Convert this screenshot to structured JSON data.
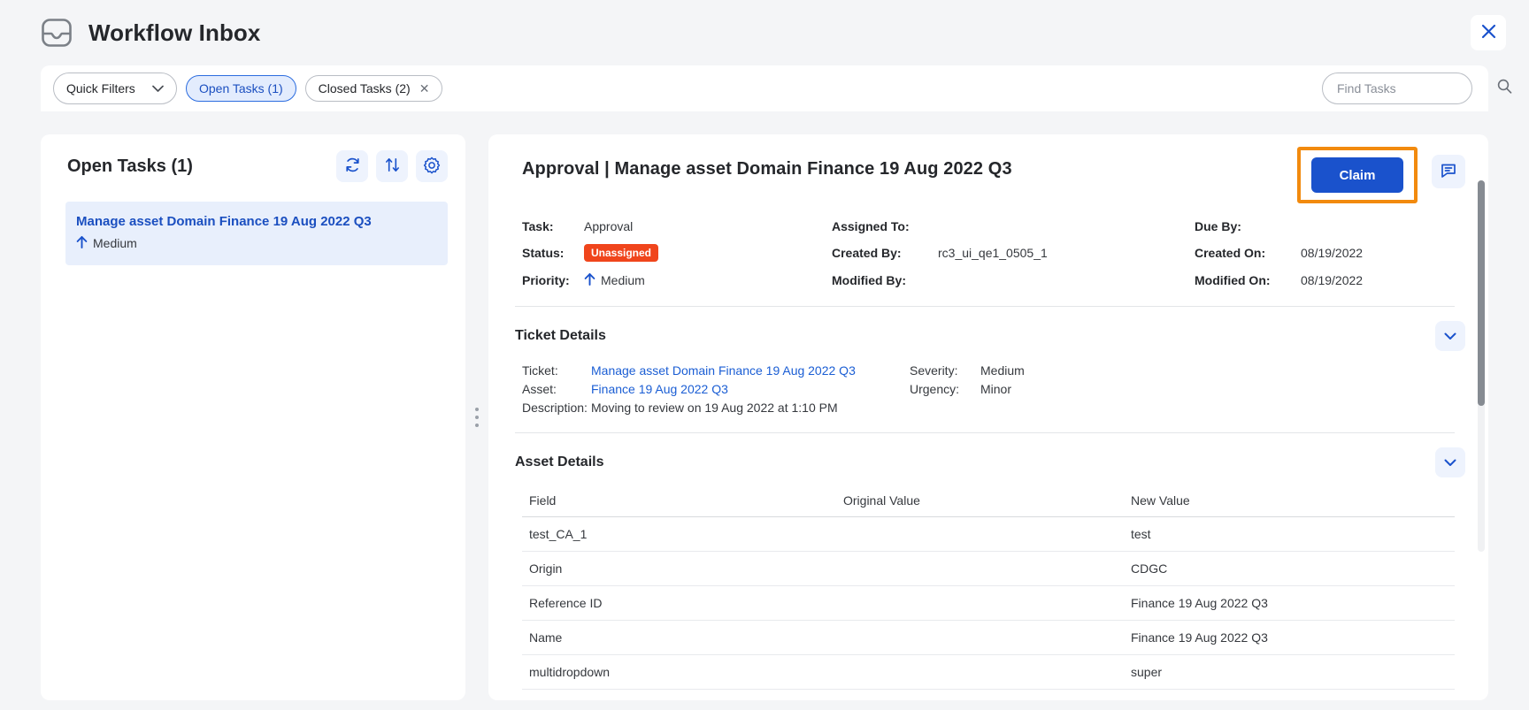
{
  "header": {
    "title": "Workflow Inbox",
    "inbox_icon": "inbox-icon",
    "close_icon": "close-icon"
  },
  "filter_bar": {
    "quick_filters_label": "Quick Filters",
    "chips": [
      {
        "label": "Open Tasks (1)",
        "active": true,
        "removable": false
      },
      {
        "label": "Closed Tasks (2)",
        "active": false,
        "removable": true
      }
    ],
    "remove_icon": "close-icon",
    "search": {
      "placeholder": "Find Tasks",
      "value": "",
      "icon": "search-icon"
    }
  },
  "list_panel": {
    "title": "Open Tasks (1)",
    "actions": [
      {
        "name": "refresh-button",
        "icon": "refresh-icon"
      },
      {
        "name": "sort-button",
        "icon": "sort-icon"
      },
      {
        "name": "settings-button",
        "icon": "gear-icon"
      }
    ],
    "tasks": [
      {
        "name": "Manage asset Domain Finance 19 Aug 2022 Q3",
        "priority": "Medium",
        "priority_icon": "arrow-up-icon",
        "selected": true
      }
    ]
  },
  "detail_panel": {
    "title": "Approval | Manage asset Domain Finance 19 Aug 2022 Q3",
    "claim_label": "Claim",
    "note_icon": "comment-icon",
    "meta": {
      "task_label": "Task:",
      "task_value": "Approval",
      "status_label": "Status:",
      "status_value": "Unassigned",
      "priority_label": "Priority:",
      "priority_value": "Medium",
      "priority_icon": "arrow-up-icon",
      "assigned_to_label": "Assigned To:",
      "assigned_to_value": "",
      "created_by_label": "Created By:",
      "created_by_value": "rc3_ui_qe1_0505_1",
      "modified_by_label": "Modified By:",
      "modified_by_value": "",
      "due_by_label": "Due By:",
      "due_by_value": "",
      "created_on_label": "Created On:",
      "created_on_value": "08/19/2022",
      "modified_on_label": "Modified On:",
      "modified_on_value": "08/19/2022"
    },
    "ticket_details": {
      "title": "Ticket Details",
      "collapse_icon": "chevron-down-icon",
      "ticket_label": "Ticket:",
      "ticket_value": "Manage asset Domain Finance 19 Aug 2022 Q3",
      "asset_label": "Asset:",
      "asset_value": "Finance 19 Aug 2022 Q3",
      "description_label": "Description:",
      "description_value": "Moving to review on 19 Aug 2022 at 1:10 PM",
      "severity_label": "Severity:",
      "severity_value": "Medium",
      "urgency_label": "Urgency:",
      "urgency_value": "Minor"
    },
    "asset_details": {
      "title": "Asset Details",
      "collapse_icon": "chevron-down-icon",
      "columns": [
        "Field",
        "Original Value",
        "New Value"
      ],
      "rows": [
        {
          "field": "test_CA_1",
          "original": "",
          "new": "test"
        },
        {
          "field": "Origin",
          "original": "",
          "new": "CDGC"
        },
        {
          "field": "Reference ID",
          "original": "",
          "new": "Finance 19 Aug 2022 Q3"
        },
        {
          "field": "Name",
          "original": "",
          "new": "Finance 19 Aug 2022 Q3"
        },
        {
          "field": "multidropdown",
          "original": "",
          "new": "super"
        }
      ]
    }
  },
  "colors": {
    "accent_blue": "#1a52cc",
    "link_blue": "#1b5ed4",
    "status_orange": "#f0451c",
    "highlight_orange": "#f28a0e",
    "page_bg": "#f4f5f7"
  }
}
